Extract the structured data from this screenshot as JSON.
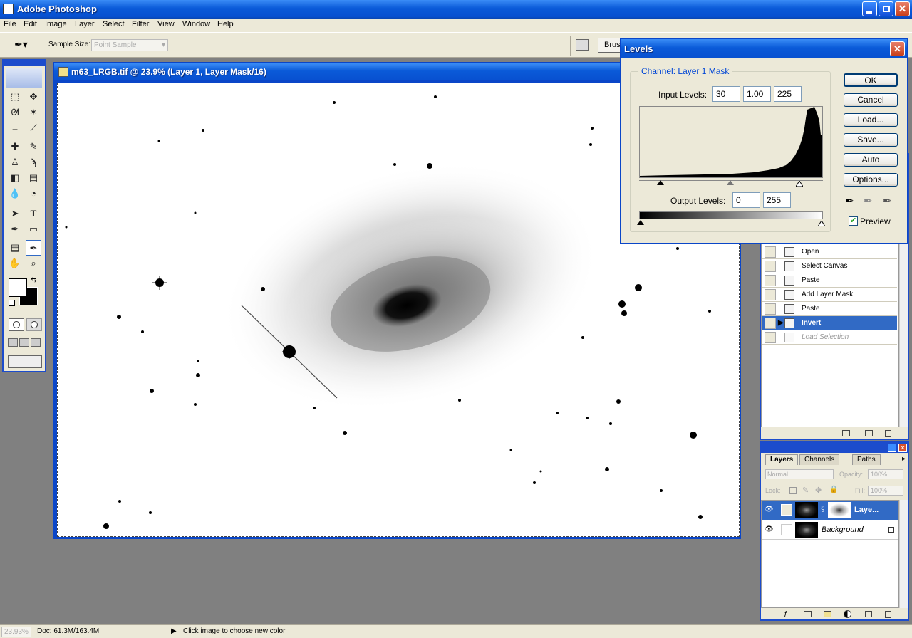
{
  "app": {
    "title": "Adobe Photoshop"
  },
  "menu": [
    "File",
    "Edit",
    "Image",
    "Layer",
    "Select",
    "Filter",
    "View",
    "Window",
    "Help"
  ],
  "options": {
    "sample_size_label": "Sample Size:",
    "sample_size_value": "Point Sample",
    "brushes_tab": "Brus"
  },
  "document": {
    "title": "m63_LRGB.tif @ 23.9% (Layer 1, Layer Mask/16)"
  },
  "levels": {
    "title": "Levels",
    "channel_label": "Channel:",
    "channel_value": "Layer 1 Mask",
    "input_label": "Input Levels:",
    "input_black": "30",
    "input_gamma": "1.00",
    "input_white": "225",
    "output_label": "Output Levels:",
    "output_black": "0",
    "output_white": "255",
    "buttons": {
      "ok": "OK",
      "cancel": "Cancel",
      "load": "Load...",
      "save": "Save...",
      "auto": "Auto",
      "options": "Options..."
    },
    "preview_label": "Preview",
    "preview_checked": true
  },
  "history": {
    "items": [
      "Open",
      "Select Canvas",
      "Paste",
      "Add Layer Mask",
      "Paste",
      "Invert",
      "Load Selection"
    ],
    "active_index": 5
  },
  "layers": {
    "tabs": [
      "Layers",
      "Channels",
      "Paths"
    ],
    "blend_mode": "Normal",
    "opacity_label": "Opacity:",
    "opacity_value": "100%",
    "lock_label": "Lock:",
    "fill_label": "Fill:",
    "fill_value": "100%",
    "rows": [
      {
        "name": "Laye..."
      },
      {
        "name": "Background"
      }
    ]
  },
  "status": {
    "zoom": "23.93%",
    "doc": "Doc: 61.3M/163.4M",
    "hint": "Click image to choose new color"
  },
  "colors": {
    "xp_blue": "#0a5ad8",
    "selection": "#316ac5",
    "panel_bg": "#ece9d8"
  }
}
